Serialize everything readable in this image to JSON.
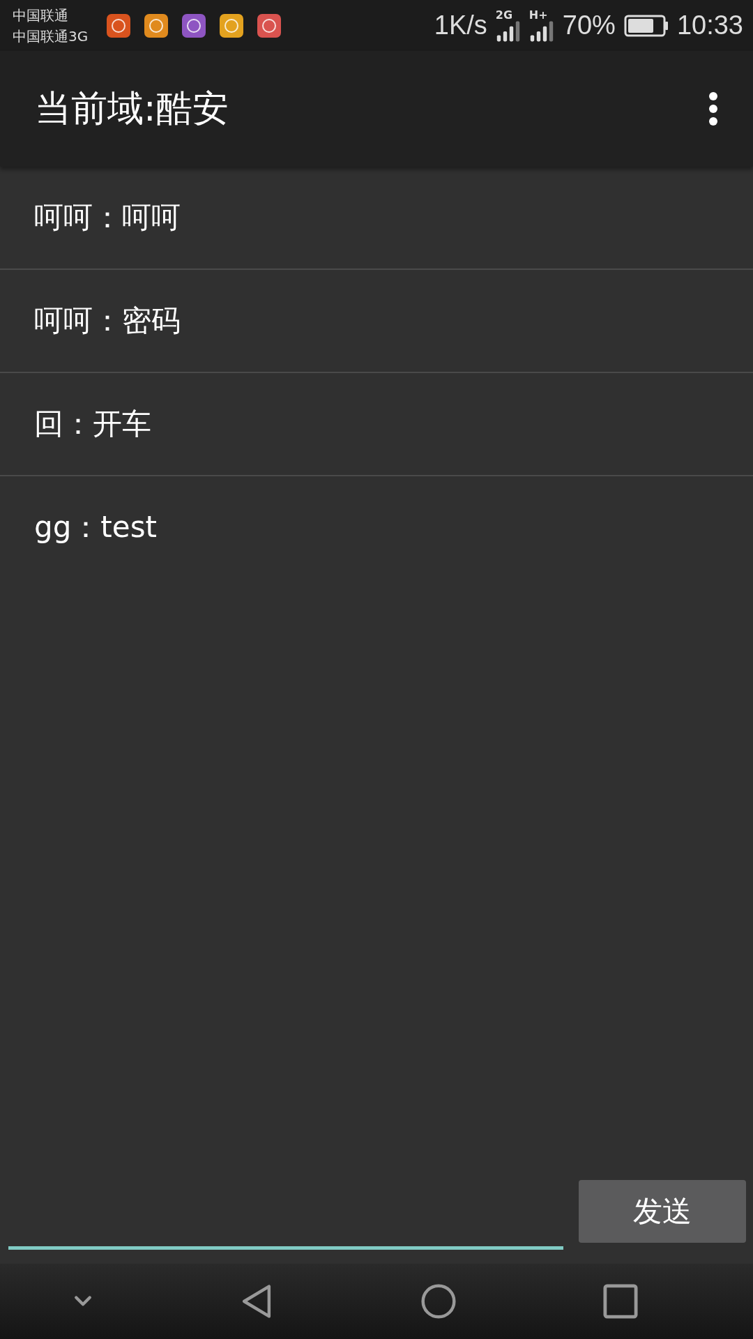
{
  "status_bar": {
    "carriers": [
      "中国联通",
      "中国联通3G"
    ],
    "speed": "1K/s",
    "network_1": "2G",
    "network_2": "H+",
    "battery": "70%",
    "time": "10:33"
  },
  "toolbar": {
    "title": "当前域:酷安"
  },
  "messages": [
    {
      "text": "呵呵：呵呵"
    },
    {
      "text": "呵呵：密码"
    },
    {
      "text": "回：开车"
    },
    {
      "text": "gg：test"
    }
  ],
  "compose": {
    "send_button": "发送"
  }
}
